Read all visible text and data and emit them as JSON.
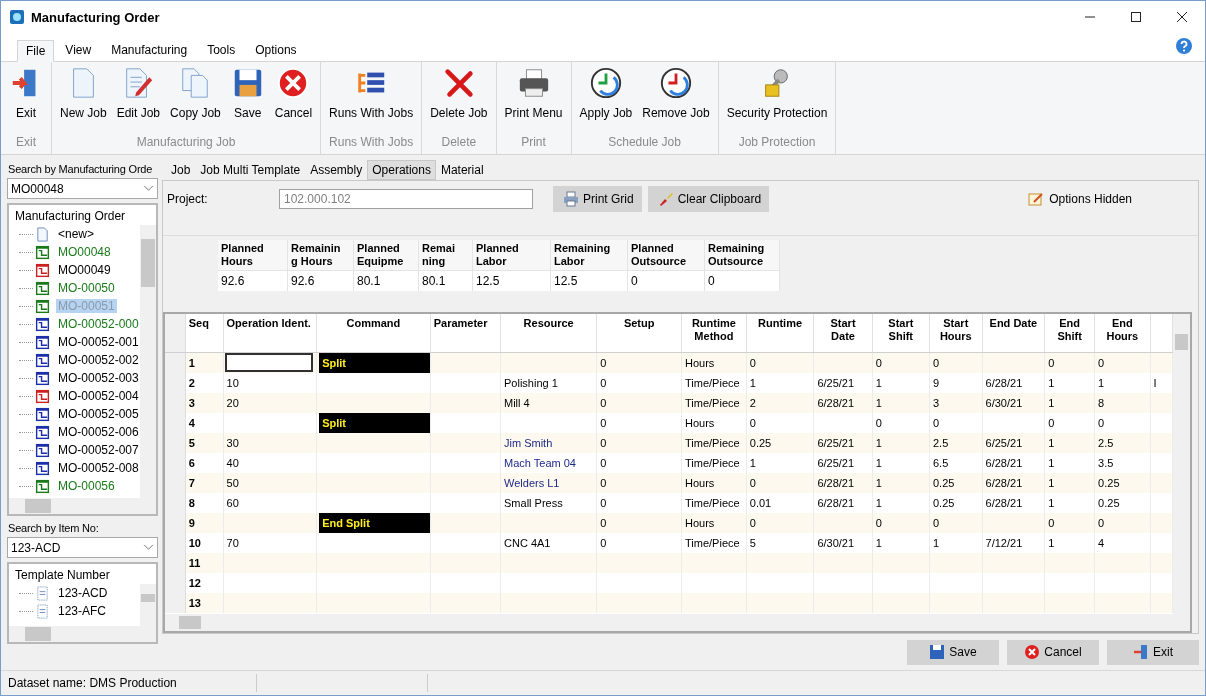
{
  "window": {
    "title": "Manufacturing Order"
  },
  "menu": [
    {
      "label": "File",
      "selected": true
    },
    {
      "label": "View",
      "selected": false
    },
    {
      "label": "Manufacturing",
      "selected": false
    },
    {
      "label": "Tools",
      "selected": false
    },
    {
      "label": "Options",
      "selected": false
    }
  ],
  "ribbon": [
    {
      "label": "Exit",
      "buttons": [
        {
          "label": "Exit",
          "kind": "exit"
        }
      ]
    },
    {
      "label": "Manufacturing Job",
      "buttons": [
        {
          "label": "New Job",
          "kind": "new"
        },
        {
          "label": "Edit Job",
          "kind": "edit"
        },
        {
          "label": "Copy Job",
          "kind": "copy"
        },
        {
          "label": "Save",
          "kind": "save"
        },
        {
          "label": "Cancel",
          "kind": "cancel"
        }
      ]
    },
    {
      "label": "Runs With Jobs",
      "buttons": [
        {
          "label": "Runs With Jobs",
          "kind": "runs"
        }
      ]
    },
    {
      "label": "Delete",
      "buttons": [
        {
          "label": "Delete Job",
          "kind": "delete"
        }
      ]
    },
    {
      "label": "Print",
      "buttons": [
        {
          "label": "Print Menu",
          "kind": "print"
        }
      ]
    },
    {
      "label": "Schedule Job",
      "buttons": [
        {
          "label": "Apply Job",
          "kind": "apply"
        },
        {
          "label": "Remove Job",
          "kind": "remove"
        }
      ]
    },
    {
      "label": "Job Protection",
      "buttons": [
        {
          "label": "Security Protection",
          "kind": "lock"
        }
      ]
    }
  ],
  "sidebar": {
    "order_search": {
      "label": "Search by Manufacturing Orde",
      "value": "MO00048"
    },
    "order_tree": {
      "title": "Manufacturing Order",
      "items": [
        {
          "label": "<new>",
          "kind": "new",
          "selected": false
        },
        {
          "label": "MO00048",
          "kind": "order",
          "color": "#1a7a1a",
          "active": true,
          "selected": false
        },
        {
          "label": "MO00049",
          "kind": "order",
          "color": "#cc2020",
          "active": false,
          "selected": false
        },
        {
          "label": "MO-00050",
          "kind": "order",
          "color": "#1a7a1a",
          "active": true,
          "selected": false
        },
        {
          "label": "MO-00051",
          "kind": "order",
          "color": "#1a7a1a",
          "active": true,
          "selected": true
        },
        {
          "label": "MO-00052-000",
          "kind": "order",
          "color": "#1c2fa8",
          "active": true,
          "selected": false
        },
        {
          "label": "MO-00052-001",
          "kind": "order",
          "color": "#1c2fa8",
          "active": false,
          "selected": false
        },
        {
          "label": "MO-00052-002",
          "kind": "order",
          "color": "#1c2fa8",
          "active": false,
          "selected": false
        },
        {
          "label": "MO-00052-003",
          "kind": "order",
          "color": "#1c2fa8",
          "active": false,
          "selected": false
        },
        {
          "label": "MO-00052-004",
          "kind": "order",
          "color": "#cc2020",
          "active": false,
          "selected": false
        },
        {
          "label": "MO-00052-005",
          "kind": "order",
          "color": "#1c2fa8",
          "active": false,
          "selected": false
        },
        {
          "label": "MO-00052-006",
          "kind": "order",
          "color": "#1c2fa8",
          "active": false,
          "selected": false
        },
        {
          "label": "MO-00052-007",
          "kind": "order",
          "color": "#1c2fa8",
          "active": false,
          "selected": false
        },
        {
          "label": "MO-00052-008",
          "kind": "order",
          "color": "#1c2fa8",
          "active": false,
          "selected": false
        },
        {
          "label": "MO-00056",
          "kind": "order",
          "color": "#1a7a1a",
          "active": true,
          "selected": false
        }
      ]
    },
    "item_search": {
      "label": "Search by Item No:",
      "value": "123-ACD"
    },
    "template_tree": {
      "title": "Template Number",
      "items": [
        {
          "label": "123-ACD"
        },
        {
          "label": "123-AFC"
        }
      ]
    }
  },
  "tabs": [
    {
      "label": "Job",
      "selected": false
    },
    {
      "label": "Job Multi Template",
      "selected": false
    },
    {
      "label": "Assembly",
      "selected": false
    },
    {
      "label": "Operations",
      "selected": true
    },
    {
      "label": "Material",
      "selected": false
    }
  ],
  "project": {
    "label": "Project:",
    "value": "102.000.102",
    "disabled": true
  },
  "actions": [
    {
      "label": "Print Grid",
      "kind": "print"
    },
    {
      "label": "Clear Clipboard",
      "kind": "clear"
    }
  ],
  "options_toggle": {
    "label": "Options Hidden"
  },
  "summary": {
    "columns": [
      "Planned Hours",
      "Remainin g Hours",
      "Planned Equipme",
      "Remai ning",
      "Planned Labor",
      "Remaining Labor",
      "Planned Outsource",
      "Remaining Outsource"
    ],
    "values": [
      "92.6",
      "92.6",
      "80.1",
      "80.1",
      "12.5",
      "12.5",
      "0",
      "0"
    ]
  },
  "grid": {
    "columns": [
      "Seq",
      "Operation Ident.",
      "Command",
      "Parameter",
      "Resource",
      "Setup",
      "Runtime Method",
      "Runtime",
      "Start Date",
      "Start Shift",
      "Start Hours",
      "End Date",
      "End Shift",
      "End Hours"
    ],
    "rows": [
      {
        "seq": "1",
        "command": "Split",
        "focused": true,
        "setup": "0",
        "runtime_method": "Hours",
        "runtime": "0",
        "start_shift": "0",
        "start_hours": "0",
        "end_shift": "0",
        "end_hours": "0"
      },
      {
        "seq": "2",
        "operation_ident": "10",
        "resource": {
          "name": "Polishing 1",
          "color": "#000000"
        },
        "setup": "0",
        "runtime_method": "Time/Piece",
        "runtime": "1",
        "start_date": "6/25/21",
        "start_shift": "1",
        "start_hours": "9",
        "end_date": "6/28/21",
        "end_shift": "1",
        "end_hours": "1",
        "column_15": "I"
      },
      {
        "seq": "3",
        "operation_ident": "20",
        "resource": {
          "name": "Mill 4",
          "color": "#000000"
        },
        "setup": "0",
        "runtime_method": "Time/Piece",
        "runtime": "2",
        "start_date": "6/28/21",
        "start_shift": "1",
        "start_hours": "3",
        "end_date": "6/30/21",
        "end_shift": "1",
        "end_hours": "8"
      },
      {
        "seq": "4",
        "command": "Split",
        "setup": "0",
        "runtime_method": "Hours",
        "runtime": "0",
        "start_shift": "0",
        "start_hours": "0",
        "end_shift": "0",
        "end_hours": "0"
      },
      {
        "seq": "5",
        "operation_ident": "30",
        "resource": {
          "name": "Jim Smith",
          "color": "#1e2a88"
        },
        "setup": "0",
        "runtime_method": "Time/Piece",
        "runtime": "0.25",
        "start_date": "6/25/21",
        "start_shift": "1",
        "start_hours": "2.5",
        "end_date": "6/25/21",
        "end_shift": "1",
        "end_hours": "2.5"
      },
      {
        "seq": "6",
        "operation_ident": "40",
        "resource": {
          "name": "Mach Team 04",
          "color": "#1e2a88"
        },
        "setup": "0",
        "runtime_method": "Time/Piece",
        "runtime": "1",
        "start_date": "6/25/21",
        "start_shift": "1",
        "start_hours": "6.5",
        "end_date": "6/28/21",
        "end_shift": "1",
        "end_hours": "3.5"
      },
      {
        "seq": "7",
        "operation_ident": "50",
        "resource": {
          "name": "Welders L1",
          "color": "#1e2a88"
        },
        "setup": "0",
        "runtime_method": "Hours",
        "runtime": "0",
        "start_date": "6/28/21",
        "start_shift": "1",
        "start_hours": "0.25",
        "end_date": "6/28/21",
        "end_shift": "1",
        "end_hours": "0.25"
      },
      {
        "seq": "8",
        "operation_ident": "60",
        "resource": {
          "name": "Small Press",
          "color": "#000000"
        },
        "setup": "0",
        "runtime_method": "Time/Piece",
        "runtime": "0.01",
        "start_date": "6/28/21",
        "start_shift": "1",
        "start_hours": "0.25",
        "end_date": "6/28/21",
        "end_shift": "1",
        "end_hours": "0.25"
      },
      {
        "seq": "9",
        "command": "End Split",
        "setup": "0",
        "runtime_method": "Hours",
        "runtime": "0",
        "start_shift": "0",
        "start_hours": "0",
        "end_shift": "0",
        "end_hours": "0"
      },
      {
        "seq": "10",
        "operation_ident": "70",
        "resource": {
          "name": "CNC 4A1",
          "color": "#000000"
        },
        "setup": "0",
        "runtime_method": "Time/Piece",
        "runtime": "5",
        "start_date": "6/30/21",
        "start_shift": "1",
        "start_hours": "1",
        "end_date": "7/12/21",
        "end_shift": "1",
        "end_hours": "4"
      },
      {
        "seq": "11"
      },
      {
        "seq": "12"
      },
      {
        "seq": "13"
      }
    ]
  },
  "footer_buttons": [
    {
      "label": "Save",
      "kind": "save"
    },
    {
      "label": "Cancel",
      "kind": "cancel"
    },
    {
      "label": "Exit",
      "kind": "exit"
    }
  ],
  "status_bar": {
    "text": "Dataset name:  DMS Production"
  }
}
